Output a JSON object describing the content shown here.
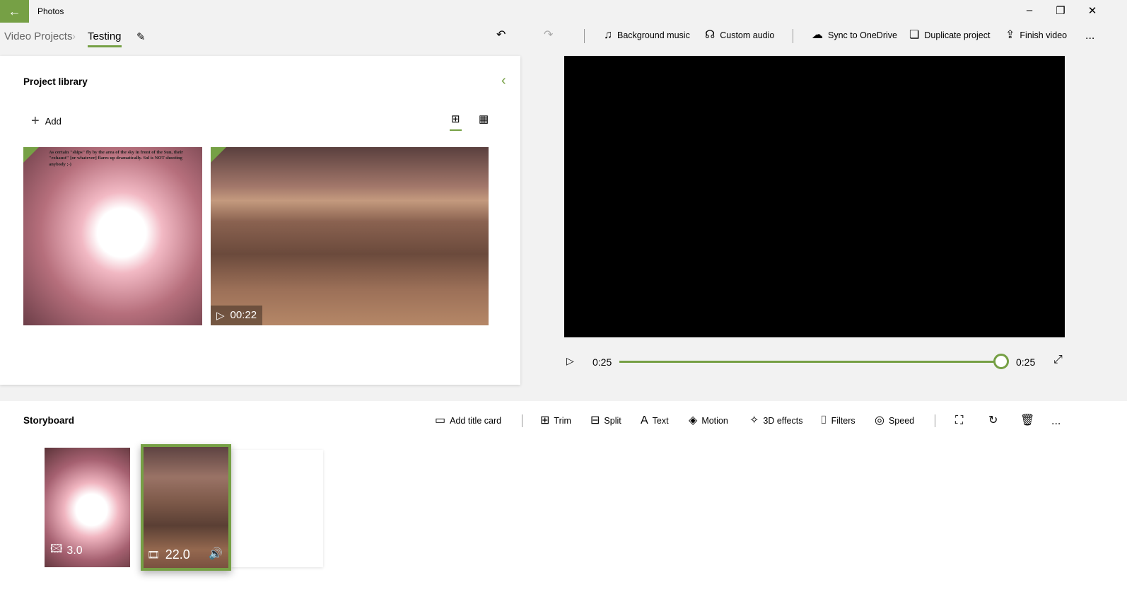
{
  "app": {
    "title": "Photos"
  },
  "breadcrumb": {
    "parent": "Video Projects",
    "current": "Testing"
  },
  "toolbar": {
    "background_music": "Background music",
    "custom_audio": "Custom audio",
    "sync": "Sync to OneDrive",
    "duplicate": "Duplicate project",
    "finish": "Finish video",
    "more": "..."
  },
  "library": {
    "title": "Project library",
    "add": "Add",
    "items": [
      {
        "caption": "As certain \"ships\" fly by the area of the sky in front of the Sun, their \"exhaust\" [or whatever] flares up dramatically. Sol is NOT shooting anybody ;-)"
      },
      {
        "duration": "00:22"
      }
    ]
  },
  "player": {
    "current": "0:25",
    "total": "0:25",
    "progress": 1.0
  },
  "storyboard": {
    "title": "Storyboard",
    "add_title_card": "Add title card",
    "trim": "Trim",
    "split": "Split",
    "text": "Text",
    "motion": "Motion",
    "effects3d": "3D effects",
    "filters": "Filters",
    "speed": "Speed",
    "more": "...",
    "clips": [
      {
        "duration": "3.0",
        "type": "image"
      },
      {
        "duration": "22.0",
        "type": "video",
        "selected": true
      }
    ]
  },
  "colors": {
    "accent": "#76a045"
  }
}
